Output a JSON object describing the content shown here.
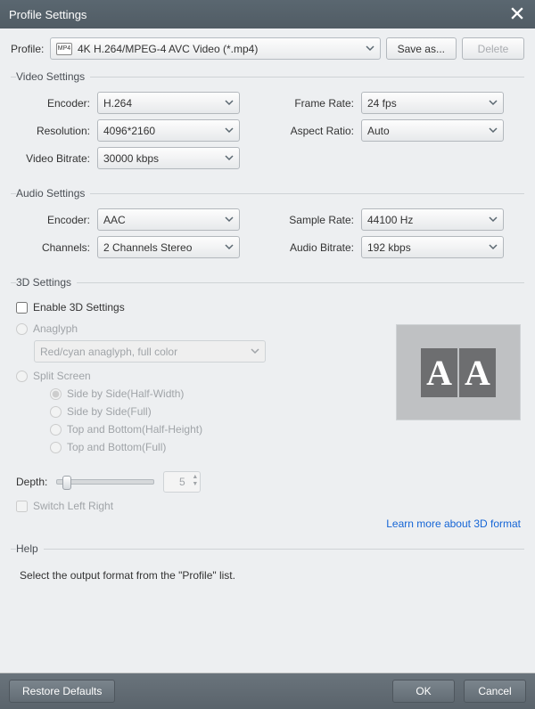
{
  "title": "Profile Settings",
  "profile": {
    "label": "Profile:",
    "selected": "4K H.264/MPEG-4 AVC Video (*.mp4)",
    "saveas": "Save as...",
    "delete": "Delete",
    "icon_text": "MP4"
  },
  "video": {
    "legend": "Video Settings",
    "encoder_label": "Encoder:",
    "encoder": "H.264",
    "resolution_label": "Resolution:",
    "resolution": "4096*2160",
    "bitrate_label": "Video Bitrate:",
    "bitrate": "30000 kbps",
    "framerate_label": "Frame Rate:",
    "framerate": "24 fps",
    "aspect_label": "Aspect Ratio:",
    "aspect": "Auto"
  },
  "audio": {
    "legend": "Audio Settings",
    "encoder_label": "Encoder:",
    "encoder": "AAC",
    "channels_label": "Channels:",
    "channels": "2 Channels Stereo",
    "sample_label": "Sample Rate:",
    "sample": "44100 Hz",
    "bitrate_label": "Audio Bitrate:",
    "bitrate": "192 kbps"
  },
  "three_d": {
    "legend": "3D Settings",
    "enable": "Enable 3D Settings",
    "anaglyph": "Anaglyph",
    "anaglyph_value": "Red/cyan anaglyph, full color",
    "split": "Split Screen",
    "opt_sbs_half": "Side by Side(Half-Width)",
    "opt_sbs_full": "Side by Side(Full)",
    "opt_tb_half": "Top and Bottom(Half-Height)",
    "opt_tb_full": "Top and Bottom(Full)",
    "depth_label": "Depth:",
    "depth_value": "5",
    "switch_lr": "Switch Left Right",
    "learn_more": "Learn more about 3D format"
  },
  "help": {
    "legend": "Help",
    "text": "Select the output format from the \"Profile\" list."
  },
  "footer": {
    "restore": "Restore Defaults",
    "ok": "OK",
    "cancel": "Cancel"
  }
}
